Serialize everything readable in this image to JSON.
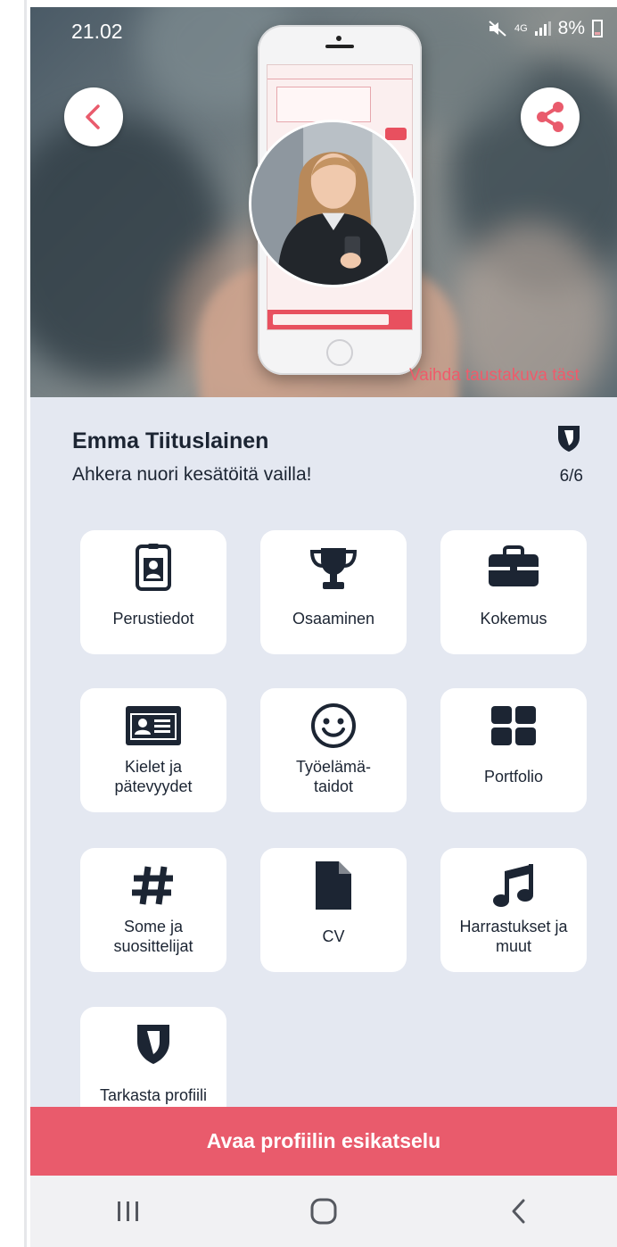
{
  "status_bar": {
    "time": "21.02",
    "network": "4G",
    "battery": "8%"
  },
  "header": {
    "back_icon": "chevron-left-icon",
    "share_icon": "share-icon",
    "change_photo_link": "Vaihda taustakuva täst"
  },
  "profile": {
    "name": "Emma Tiituslainen",
    "tagline": "Ahkera nuori kesätöitä vailla!",
    "score": "6/6",
    "score_icon": "shield-icon"
  },
  "tiles": [
    {
      "label": "Perustiedot",
      "icon": "id-badge-icon"
    },
    {
      "label": "Osaaminen",
      "icon": "trophy-icon"
    },
    {
      "label": "Kokemus",
      "icon": "briefcase-icon"
    },
    {
      "label": "Kielet ja\npätevyydet",
      "icon": "id-card-icon"
    },
    {
      "label": "Työelämä-\ntaidot",
      "icon": "smiley-icon"
    },
    {
      "label": "Portfolio",
      "icon": "grid-icon"
    },
    {
      "label": "Some ja\nsuosittelijat",
      "icon": "hashtag-icon"
    },
    {
      "label": "CV",
      "icon": "document-icon"
    },
    {
      "label": "Harrastukset ja\nmuut",
      "icon": "music-note-icon"
    },
    {
      "label": "Tarkasta profiili",
      "icon": "shield-icon"
    }
  ],
  "cta": {
    "label": "Avaa profiilin esikatselu"
  },
  "navbar": {
    "recent_icon": "recent-apps-icon",
    "home_icon": "home-icon",
    "back_icon": "back-icon"
  },
  "colors": {
    "accent": "#e95b6c",
    "background": "#e4e8f1",
    "text": "#1c2533"
  }
}
